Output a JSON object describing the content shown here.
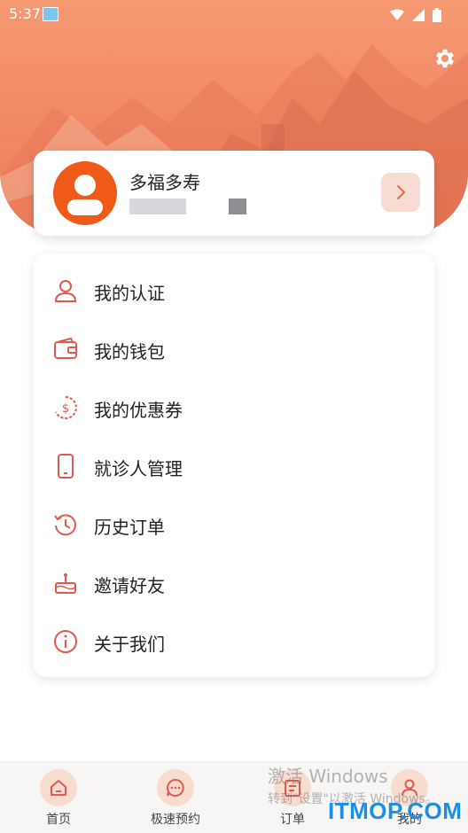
{
  "status_bar": {
    "time": "5:37"
  },
  "profile": {
    "name": "多福多寿"
  },
  "menu": {
    "items": [
      {
        "label": "我的认证",
        "icon": "person-icon"
      },
      {
        "label": "我的钱包",
        "icon": "wallet-icon"
      },
      {
        "label": "我的优惠券",
        "icon": "coupon-icon"
      },
      {
        "label": "就诊人管理",
        "icon": "phone-icon"
      },
      {
        "label": "历史订单",
        "icon": "history-icon"
      },
      {
        "label": "邀请好友",
        "icon": "cake-icon"
      },
      {
        "label": "关于我们",
        "icon": "info-icon"
      }
    ]
  },
  "bottom_nav": {
    "items": [
      {
        "label": "首页",
        "icon": "home-icon"
      },
      {
        "label": "极速预约",
        "icon": "chat-icon"
      },
      {
        "label": "订单",
        "icon": "order-icon"
      },
      {
        "label": "我的",
        "icon": "user-icon"
      }
    ]
  },
  "watermark": {
    "line1": "激活 Windows",
    "line2": "转到\"设置\"以激活 Windows。",
    "brand": "ITMOP.COM"
  },
  "colors": {
    "accent": "#ef5a18",
    "icon_red": "#e05a4e",
    "hero": "#f28b67"
  }
}
